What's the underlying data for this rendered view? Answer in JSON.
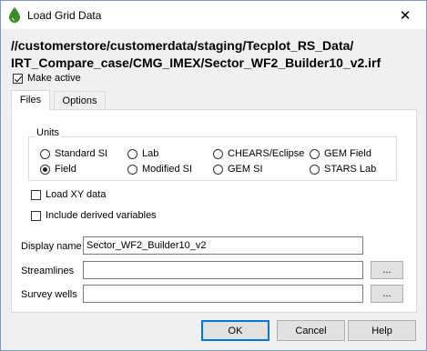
{
  "window": {
    "title": "Load Grid Data",
    "close_glyph": "✕",
    "icon": "drop-icon",
    "icon_color": "#3d8a2a"
  },
  "path": {
    "line1": "//customerstore/customerdata/staging/Tecplot_RS_Data/",
    "line2": "IRT_Compare_case/CMG_IMEX/Sector_WF2_Builder10_v2.irf"
  },
  "make_active": {
    "label": "Make active",
    "checked": true
  },
  "tabs": [
    {
      "label": "Files",
      "active": true
    },
    {
      "label": "Options",
      "active": false
    }
  ],
  "units": {
    "title": "Units",
    "options": [
      {
        "label": "Standard SI",
        "selected": false
      },
      {
        "label": "Lab",
        "selected": false
      },
      {
        "label": "CHEARS/Eclipse",
        "selected": false
      },
      {
        "label": "GEM Field",
        "selected": false
      },
      {
        "label": "Field",
        "selected": true
      },
      {
        "label": "Modified SI",
        "selected": false
      },
      {
        "label": "GEM SI",
        "selected": false
      },
      {
        "label": "STARS Lab",
        "selected": false
      }
    ]
  },
  "load_xy": {
    "label": "Load XY data",
    "checked": false
  },
  "derived": {
    "label": "Include derived variables",
    "checked": false
  },
  "fields": {
    "display_name": {
      "label": "Display name",
      "value": "Sector_WF2_Builder10_v2"
    },
    "streamlines": {
      "label": "Streamlines",
      "value": "",
      "browse": "..."
    },
    "survey_wells": {
      "label": "Survey wells",
      "value": "",
      "browse": "..."
    }
  },
  "buttons": {
    "ok": "OK",
    "cancel": "Cancel",
    "help": "Help"
  },
  "colors": {
    "accent": "#0078d7"
  }
}
